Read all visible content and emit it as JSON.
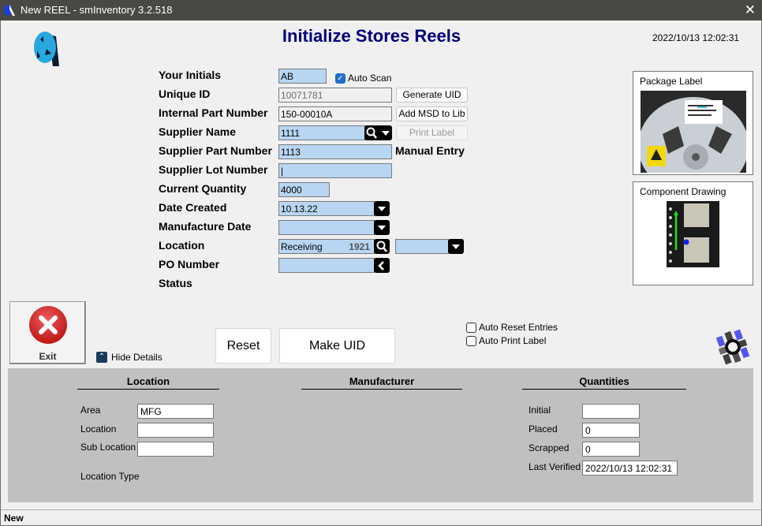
{
  "window": {
    "title": "New REEL - smInventory 3.2.518",
    "close_label": "✕"
  },
  "header": {
    "title": "Initialize Stores Reels",
    "datetime": "2022/10/13 12:02:31"
  },
  "form": {
    "your_initials": {
      "label": "Your Initials",
      "value": "AB"
    },
    "auto_scan": {
      "label": "Auto Scan",
      "checked": true
    },
    "unique_id": {
      "label": "Unique ID",
      "value": "10071781"
    },
    "generate_uid_label": "Generate UID",
    "internal_part_number": {
      "label": "Internal Part Number",
      "value": "150-00010A"
    },
    "add_msd_label": "Add MSD to Lib",
    "supplier_name": {
      "label": "Supplier Name",
      "value": "1111"
    },
    "print_label_label": "Print Label",
    "supplier_part_number": {
      "label": "Supplier Part Number",
      "value": "1113"
    },
    "manual_entry_label": "Manual Entry",
    "supplier_lot_number": {
      "label": "Supplier Lot Number",
      "value": "|"
    },
    "current_quantity": {
      "label": "Current Quantity",
      "value": "4000"
    },
    "date_created": {
      "label": "Date Created",
      "value": "10.13.22"
    },
    "manufacture_date": {
      "label": "Manufacture Date",
      "value": ""
    },
    "location": {
      "label": "Location",
      "value": "Receiving",
      "code": "1921",
      "sub_value": ""
    },
    "po_number": {
      "label": "PO Number",
      "value": ""
    },
    "status": {
      "label": "Status",
      "value": ""
    }
  },
  "images": {
    "package_label_caption": "Package Label",
    "component_drawing_caption": "Component Drawing"
  },
  "actions": {
    "exit_label": "Exit",
    "hide_details_label": "Hide Details",
    "reset_label": "Reset",
    "make_uid_label": "Make UID",
    "auto_reset_entries": {
      "label": "Auto Reset Entries",
      "checked": false
    },
    "auto_print_label": {
      "label": "Auto Print Label",
      "checked": false
    }
  },
  "details": {
    "location_section": {
      "title": "Location",
      "area": {
        "label": "Area",
        "value": "MFG"
      },
      "location": {
        "label": "Location",
        "value": ""
      },
      "sub_location": {
        "label": "Sub Location",
        "value": ""
      },
      "location_type": {
        "label": "Location Type",
        "value": ""
      }
    },
    "manufacturer_section": {
      "title": "Manufacturer"
    },
    "quantities_section": {
      "title": "Quantities",
      "initial": {
        "label": "Initial",
        "value": ""
      },
      "placed": {
        "label": "Placed",
        "value": "0"
      },
      "scrapped": {
        "label": "Scrapped",
        "value": "0"
      },
      "last_verified": {
        "label": "Last Verified",
        "value": "2022/10/13 12:02:31"
      }
    }
  },
  "status_bar": {
    "text": "New"
  },
  "colors": {
    "title_blue": "#00007a",
    "field_blue": "#b8d6f2",
    "titlebar": "#4a4845",
    "details_gray": "#c0c0c0"
  }
}
